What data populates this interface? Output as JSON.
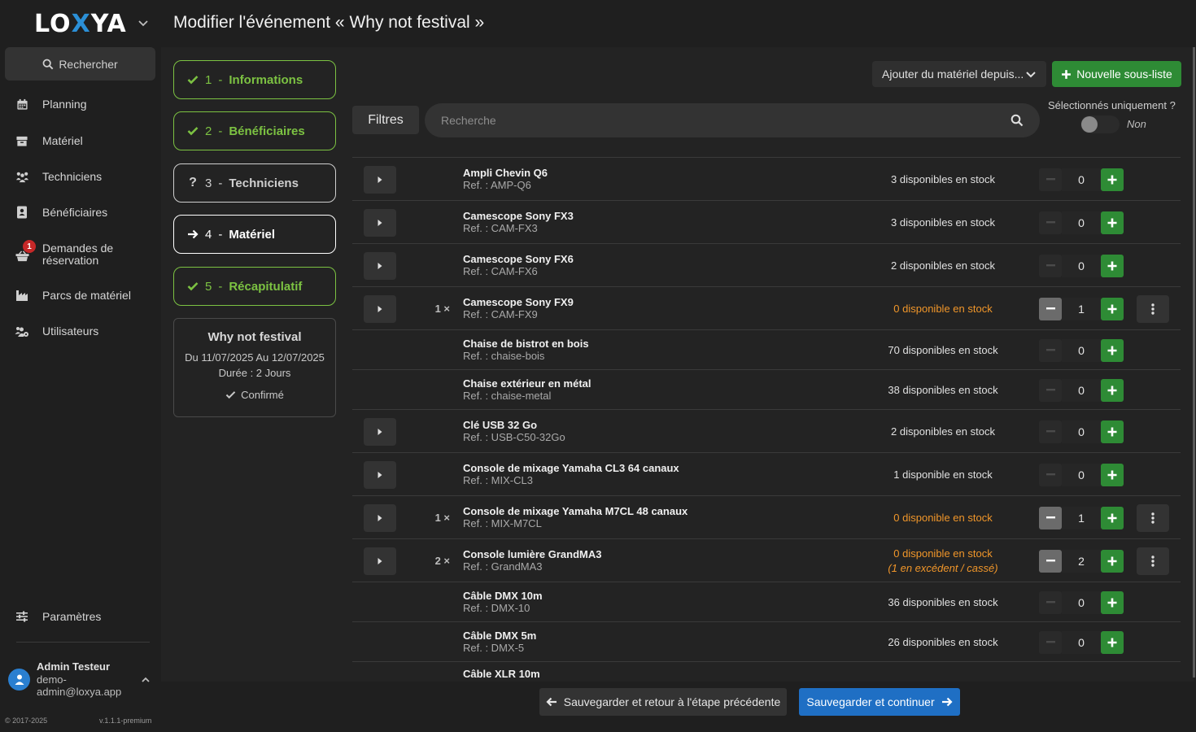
{
  "app": {
    "logo_left": "LO",
    "logo_x": "X",
    "logo_right": "YA"
  },
  "header": {
    "title": "Modifier l'événement « Why not festival »"
  },
  "sidebar": {
    "search_label": "Rechercher",
    "items": [
      {
        "label": "Planning",
        "icon": "calendar-icon"
      },
      {
        "label": "Matériel",
        "icon": "box-icon"
      },
      {
        "label": "Techniciens",
        "icon": "people-icon"
      },
      {
        "label": "Bénéficiaires",
        "icon": "address-book-icon"
      },
      {
        "label": "Demandes de réservation",
        "icon": "basket-icon",
        "badge": "1"
      },
      {
        "label": "Parcs de matériel",
        "icon": "industry-icon"
      },
      {
        "label": "Utilisateurs",
        "icon": "users-gear-icon"
      }
    ],
    "settings_label": "Paramètres",
    "user": {
      "name": "Admin Testeur",
      "email": "demo-admin@loxya.app"
    },
    "copyright": "© 2017-2025",
    "version": "v.1.1.1-premium"
  },
  "steps": [
    {
      "num": "1",
      "label": "Informations",
      "state": "done"
    },
    {
      "num": "2",
      "label": "Bénéficiaires",
      "state": "done"
    },
    {
      "num": "3",
      "label": "Techniciens",
      "state": "pending"
    },
    {
      "num": "4",
      "label": "Matériel",
      "state": "active"
    },
    {
      "num": "5",
      "label": "Récapitulatif",
      "state": "done"
    }
  ],
  "event_card": {
    "title": "Why not festival",
    "dates": "Du 11/07/2025 Au 12/07/2025",
    "duration": "Durée : 2 Jours",
    "status": "Confirmé"
  },
  "toolbar": {
    "add_from_label": "Ajouter du matériel depuis...",
    "new_sublist_label": "Nouvelle sous-liste",
    "filters_label": "Filtres",
    "search_placeholder": "Recherche",
    "selected_only_label": "Sélectionnés uniquement ?",
    "selected_only_value": "Non"
  },
  "materials": [
    {
      "name": "Ampli Chevin Q6",
      "ref": "Ref. : AMP-Q6",
      "stock": "3 disponibles en stock",
      "warn": false,
      "qty": "0",
      "prefix": "",
      "expandable": true
    },
    {
      "name": "Camescope Sony FX3",
      "ref": "Ref. : CAM-FX3",
      "stock": "3 disponibles en stock",
      "warn": false,
      "qty": "0",
      "prefix": "",
      "expandable": true
    },
    {
      "name": "Camescope Sony FX6",
      "ref": "Ref. : CAM-FX6",
      "stock": "2 disponibles en stock",
      "warn": false,
      "qty": "0",
      "prefix": "",
      "expandable": true
    },
    {
      "name": "Camescope Sony FX9",
      "ref": "Ref. : CAM-FX9",
      "stock": "0 disponible en stock",
      "warn": true,
      "qty": "1",
      "prefix": "1 ×",
      "expandable": true
    },
    {
      "name": "Chaise de bistrot en bois",
      "ref": "Ref. : chaise-bois",
      "stock": "70 disponibles en stock",
      "warn": false,
      "qty": "0",
      "prefix": "",
      "expandable": false
    },
    {
      "name": "Chaise extérieur en métal",
      "ref": "Ref. : chaise-metal",
      "stock": "38 disponibles en stock",
      "warn": false,
      "qty": "0",
      "prefix": "",
      "expandable": false
    },
    {
      "name": "Clé USB 32 Go",
      "ref": "Ref. : USB-C50-32Go",
      "stock": "2 disponibles en stock",
      "warn": false,
      "qty": "0",
      "prefix": "",
      "expandable": true
    },
    {
      "name": "Console de mixage Yamaha CL3 64 canaux",
      "ref": "Ref. : MIX-CL3",
      "stock": "1 disponible en stock",
      "warn": false,
      "qty": "0",
      "prefix": "",
      "expandable": true
    },
    {
      "name": "Console de mixage Yamaha M7CL 48 canaux",
      "ref": "Ref. : MIX-M7CL",
      "stock": "0 disponible en stock",
      "warn": true,
      "qty": "1",
      "prefix": "1 ×",
      "expandable": true
    },
    {
      "name": "Console lumière GrandMA3",
      "ref": "Ref. : GrandMA3",
      "stock": "0 disponible en stock",
      "excess": "(1 en excédent / cassé)",
      "warn": true,
      "qty": "2",
      "prefix": "2 ×",
      "expandable": true
    },
    {
      "name": "Câble DMX 10m",
      "ref": "Ref. : DMX-10",
      "stock": "36 disponibles en stock",
      "warn": false,
      "qty": "0",
      "prefix": "",
      "expandable": false
    },
    {
      "name": "Câble DMX 5m",
      "ref": "Ref. : DMX-5",
      "stock": "26 disponibles en stock",
      "warn": false,
      "qty": "0",
      "prefix": "",
      "expandable": false
    },
    {
      "name": "Câble XLR 10m",
      "ref": "",
      "stock": "",
      "warn": false,
      "qty": "",
      "prefix": "",
      "expandable": false
    }
  ],
  "footer": {
    "back_label": "Sauvegarder et retour à l'étape précédente",
    "next_label": "Sauvegarder et continuer"
  },
  "colors": {
    "accent_green": "#7cc242",
    "primary_blue": "#1f6fc4",
    "warning_orange": "#f0962a",
    "add_green": "#2e8b35"
  }
}
